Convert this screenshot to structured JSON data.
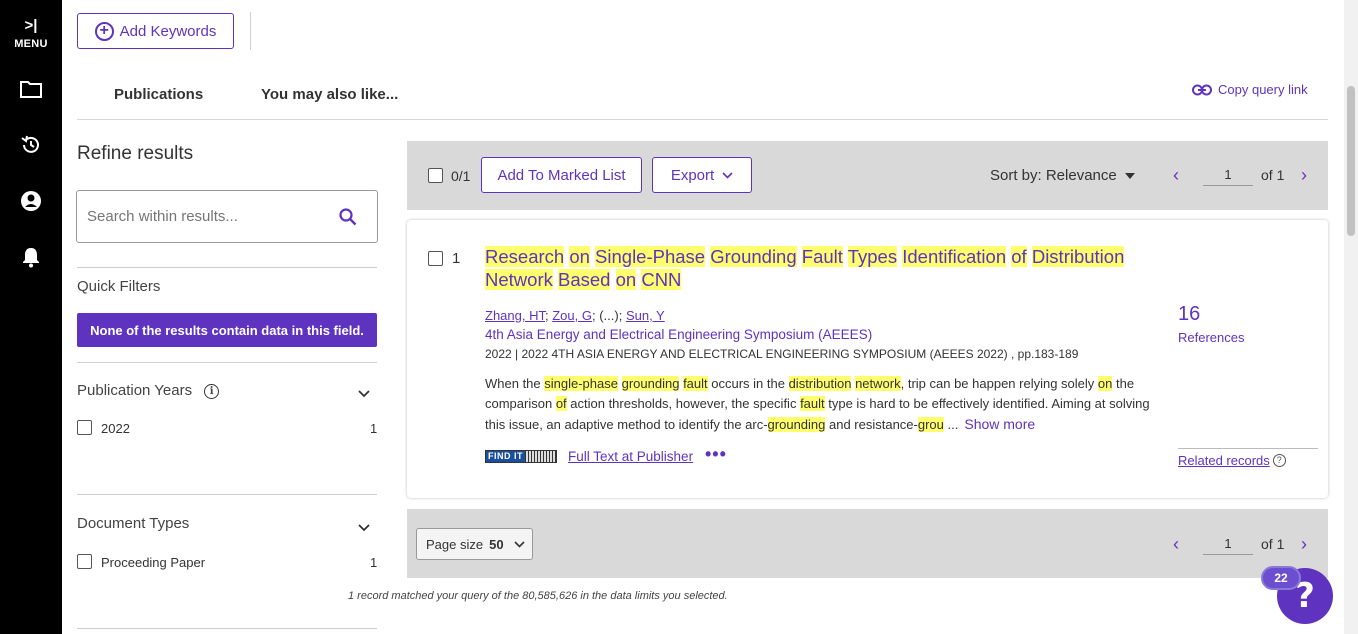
{
  "sidebar": {
    "menu_arrow": ">|",
    "menu_label": "MENU",
    "icons": [
      "folder-icon",
      "history-icon",
      "account-icon",
      "bell-icon"
    ]
  },
  "header": {
    "add_keywords_label": "Add Keywords",
    "add_keywords_plus": "+",
    "tabs": [
      {
        "label": "Publications"
      },
      {
        "label": "You may also like..."
      }
    ],
    "copy_query_link": "Copy query link"
  },
  "refine": {
    "title": "Refine results",
    "search_placeholder": "Search within results...",
    "quick_filters": {
      "title": "Quick Filters",
      "banner": "None of the results contain data in this field."
    },
    "publication_years": {
      "title": "Publication Years",
      "info_glyph": "i",
      "items": [
        {
          "label": "2022",
          "count": "1"
        }
      ]
    },
    "document_types": {
      "title": "Document Types",
      "items": [
        {
          "label": "Proceeding Paper",
          "count": "1"
        }
      ]
    }
  },
  "toolbar": {
    "selected_count": "0/1",
    "add_to_marked_list": "Add To Marked List",
    "export": "Export",
    "sort_label": "Sort by: Relevance",
    "page_current": "1",
    "page_of": "of 1",
    "prev_arrow": "‹",
    "next_arrow": "›"
  },
  "record": {
    "number": "1",
    "title_words": [
      "Research",
      "on",
      "Single-Phase",
      "Grounding",
      "Fault",
      "Types",
      "Identification",
      "of",
      "Distribution",
      "Network",
      "Based",
      "on",
      "CNN"
    ],
    "authors": {
      "first": "Zhang, HT",
      "second": "Zou, G",
      "ellipsis": "(...)",
      "last": "Sun, Y"
    },
    "conference": "4th Asia Energy and Electrical Engineering Symposium (AEEES)",
    "pub_info": "2022 | 2022 4TH ASIA ENERGY AND ELECTRICAL ENGINEERING SYMPOSIUM (AEEES 2022) , pp.183-189",
    "abstract_segments": [
      {
        "t": "When the ",
        "h": false
      },
      {
        "t": "single-phase",
        "h": true
      },
      {
        "t": " ",
        "h": false
      },
      {
        "t": "grounding",
        "h": true
      },
      {
        "t": " ",
        "h": false
      },
      {
        "t": "fault",
        "h": true
      },
      {
        "t": " occurs in the ",
        "h": false
      },
      {
        "t": "distribution",
        "h": true
      },
      {
        "t": " ",
        "h": false
      },
      {
        "t": "network",
        "h": true
      },
      {
        "t": ", trip can be happen relying solely ",
        "h": false
      },
      {
        "t": "on",
        "h": true
      },
      {
        "t": " the comparison ",
        "h": false
      },
      {
        "t": "of",
        "h": true
      },
      {
        "t": " action thresholds, however, the specific ",
        "h": false
      },
      {
        "t": "fault",
        "h": true
      },
      {
        "t": " type is hard to be effectively identified. Aiming at solving this issue, an adaptive method to identify the arc-",
        "h": false
      },
      {
        "t": "grounding",
        "h": true
      },
      {
        "t": " and resistance-",
        "h": false
      },
      {
        "t": "grou",
        "h": true
      },
      {
        "t": " ...",
        "h": false
      }
    ],
    "show_more": "Show more",
    "findit_label": "FIND IT",
    "full_text": "Full Text at Publisher",
    "more_dots": "•••",
    "references_count": "16",
    "references_label": "References",
    "related_records": "Related records",
    "related_help": "?"
  },
  "bottom": {
    "page_size_label": "Page size",
    "page_size_value": "50",
    "page_current": "1",
    "page_of": "of 1",
    "footnote": "1 record matched your query of the 80,585,626 in the data limits you selected."
  },
  "help": {
    "badge": "22",
    "glyph": "?"
  },
  "colors": {
    "accent": "#5e33bf",
    "highlight": "#ffff6e",
    "sidebar_bg": "#000000"
  }
}
